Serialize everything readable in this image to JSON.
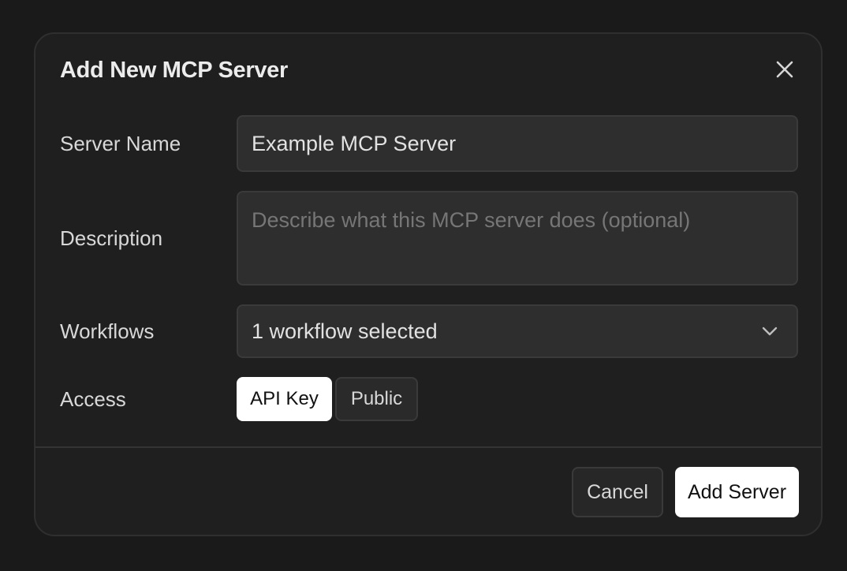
{
  "dialog": {
    "title": "Add New MCP Server",
    "close_icon": "close-icon"
  },
  "form": {
    "server_name": {
      "label": "Server Name",
      "value": "Example MCP Server"
    },
    "description": {
      "label": "Description",
      "value": "",
      "placeholder": "Describe what this MCP server does (optional)"
    },
    "workflows": {
      "label": "Workflows",
      "selected": "1 workflow selected",
      "icon": "chevron-down-icon"
    },
    "access": {
      "label": "Access",
      "options": [
        "API Key",
        "Public"
      ],
      "selected": "API Key"
    }
  },
  "footer": {
    "cancel_label": "Cancel",
    "submit_label": "Add Server"
  },
  "colors": {
    "background": "#1a1a1a",
    "modal": "#1f1f1f",
    "field": "#2e2e2e",
    "primary_button": "#ffffff"
  }
}
